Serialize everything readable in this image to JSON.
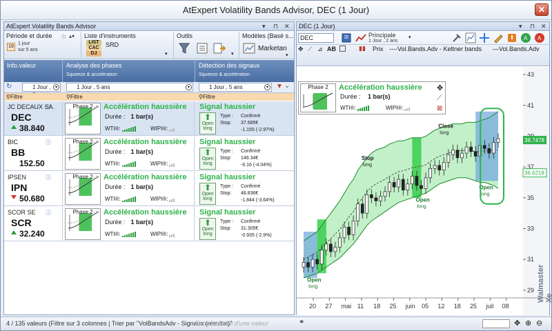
{
  "app": {
    "title": "AtExpert Volatility Bands Advisor, DEC (1 Jour)",
    "close_glyph": "✕"
  },
  "left_panel": {
    "title": "AtExpert Volatility Bands Advisor",
    "controls": [
      "▾",
      "⊓",
      "✕"
    ],
    "ribbon": {
      "period_label": "Période et durée",
      "period_value": "1 jour",
      "period_sub": "sur 5 ans",
      "instruments_label": "Liste d'instruments",
      "instruments": [
        "LIST",
        "CAC",
        "DJ"
      ],
      "instrument_selected": "SRD",
      "tools_label": "Outils",
      "models_label": "Modèles (Basé s...",
      "models_value": "Marketan"
    },
    "columns": [
      {
        "title": "Info.valeur",
        "sub": "",
        "filter": "Filtre"
      },
      {
        "title": "Analyse des phases",
        "sub": "Squeeze & accélération",
        "filter": "Filtre"
      },
      {
        "title": "Détection des signaux",
        "sub": "Squeeze & accélération",
        "filter": "Filtre"
      }
    ],
    "selectors": [
      "1 Jour , 2...",
      "1 Jour , 5 ans",
      "1 Jour , 5 ans"
    ],
    "rows": [
      {
        "name": "JC DECAUX SA.",
        "ticker": "DEC",
        "price": "38.840",
        "dir": "up",
        "phase": "Phase 2",
        "phase_status": "Accélération haussière",
        "duration_label": "Durée :",
        "duration": "1 bar(s)",
        "wti_label": "WTI®:",
        "wipi_label": "WIPI®:",
        "signal": "Signal haussier",
        "open_label": "Open",
        "open_sub": "long",
        "type_label": "Type :",
        "type": "Confirmé",
        "stop_label": "Stop:",
        "stop": "37.685€",
        "stop_change": "-1.155 (-2.97%)"
      },
      {
        "name": "BIC",
        "ticker": "BB",
        "price": "152.50",
        "dir": "none",
        "phase": "Phase 2",
        "phase_status": "Accélération haussière",
        "duration_label": "Durée :",
        "duration": "1 bar(s)",
        "wti_label": "WTI®:",
        "wipi_label": "WIPI®:",
        "signal": "Signal haussier",
        "open_label": "Open",
        "open_sub": "long",
        "type_label": "Type :",
        "type": "Confirmé",
        "stop_label": "Stop:",
        "stop": "146.34€",
        "stop_change": "-6.16 (-4.04%)"
      },
      {
        "name": "IPSEN",
        "ticker": "IPN",
        "price": "50.680",
        "dir": "down",
        "phase": "Phase 2",
        "phase_status": "Accélération haussière",
        "duration_label": "Durée :",
        "duration": "1 bar(s)",
        "wti_label": "WTI®:",
        "wipi_label": "WIPI®:",
        "signal": "Signal haussier",
        "open_label": "Open",
        "open_sub": "long",
        "type_label": "Type :",
        "type": "Confirmé",
        "stop_label": "Stop:",
        "stop": "48.836€",
        "stop_change": "-1.844 (-3.64%)"
      },
      {
        "name": "SCOR SE",
        "ticker": "SCR",
        "price": "32.240",
        "dir": "up",
        "phase": "Phase 2",
        "phase_status": "Accélération haussière",
        "duration_label": "Durée :",
        "duration": "1 bar(s)",
        "wti_label": "WTI®:",
        "wipi_label": "WIPI®:",
        "signal": "Signal haussier",
        "open_label": "Open",
        "open_sub": "long",
        "type_label": "Type :",
        "type": "Confirmé",
        "stop_label": "Stop:",
        "stop": "31.305€",
        "stop_change": "-0.935 (-2.9%)"
      }
    ]
  },
  "status_bar": {
    "text": "4 / 135 valeurs (Filtre sur 3 colonnes | Trier par \"VolBandsAdv - Signaux (résultat)\"",
    "overlay": "Entrez ici tout d'une valeur"
  },
  "right_panel": {
    "title": "DEC (1 Jour)",
    "controls": [
      "▾",
      "⊓",
      "✕"
    ],
    "symbol": "DEC",
    "principale_label": "Principale",
    "principale_sub": "1 Jour , 2 ans",
    "legend": [
      "Prix",
      "Vol.Bands.Adv - Keltner bands",
      "Vol.Bands.Adv"
    ],
    "info": {
      "phase": "Phase 2",
      "status": "Accélération haussière",
      "duration_label": "Durée :",
      "duration": "1 bar(s)",
      "wti_label": "WTI®:",
      "wipi_label": "WIPI®:"
    },
    "watermark": "Walmaster Xe"
  },
  "chart_data": {
    "type": "candlestick",
    "x_ticks": [
      "20",
      "27",
      "mai",
      "11",
      "18",
      "25",
      "juin",
      "05",
      "12",
      "18",
      "25",
      "juil",
      "08"
    ],
    "y_ticks": [
      "43",
      "41",
      "39",
      "37",
      "35",
      "33",
      "31",
      "29"
    ],
    "ylim": [
      28.5,
      43.5
    ],
    "current_price": "38.7478",
    "stop_price": "36.6218",
    "annotations": [
      {
        "label": "Open",
        "sub": "long",
        "x": 0.05
      },
      {
        "label": "Stop",
        "sub": "long",
        "x": 0.33
      },
      {
        "label": "Open",
        "sub": "long",
        "x": 0.6
      },
      {
        "label": "Close",
        "sub": "long",
        "x": 0.73
      },
      {
        "label": "Open",
        "sub": "long",
        "x": 0.93
      }
    ],
    "close_series": [
      30.8,
      30.5,
      31.0,
      30.7,
      31.6,
      32.0,
      31.5,
      31.8,
      32.4,
      33.1,
      32.6,
      33.5,
      34.6,
      34.0,
      35.2,
      35.0,
      34.8,
      35.1,
      35.4,
      36.0,
      35.7,
      36.2,
      35.5,
      35.9,
      36.4,
      35.8,
      35.6,
      36.3,
      36.9,
      37.1,
      36.8,
      37.3,
      37.8,
      38.1,
      37.6,
      37.9,
      38.3,
      38.0,
      37.7,
      38.4,
      38.2,
      37.9,
      38.6,
      38.84
    ],
    "keltner_upper": [
      32.2,
      32.4,
      32.6,
      32.8,
      33.2,
      33.6,
      34.0,
      34.4,
      34.8,
      35.3,
      35.8,
      36.2,
      36.8,
      37.2,
      37.6,
      37.9,
      38.1,
      38.2,
      38.3,
      38.5,
      38.6,
      38.7,
      38.7,
      38.8,
      38.9,
      38.9,
      38.9,
      39.0,
      39.2,
      39.4,
      39.5,
      39.6,
      39.7,
      39.8,
      39.8,
      39.8,
      39.9,
      39.9,
      39.9,
      40.0,
      40.1,
      40.2,
      40.4,
      40.6
    ],
    "keltner_lower": [
      29.8,
      29.9,
      30.0,
      30.1,
      30.3,
      30.5,
      30.7,
      30.9,
      31.1,
      31.4,
      31.7,
      32.0,
      32.4,
      32.8,
      33.2,
      33.5,
      33.7,
      33.9,
      34.1,
      34.3,
      34.5,
      34.7,
      34.8,
      34.9,
      35.0,
      35.1,
      35.2,
      35.3,
      35.5,
      35.7,
      35.9,
      36.0,
      36.1,
      36.2,
      36.3,
      36.3,
      36.3,
      36.2,
      36.1,
      36.0,
      36.0,
      35.9,
      35.8,
      35.6
    ]
  }
}
